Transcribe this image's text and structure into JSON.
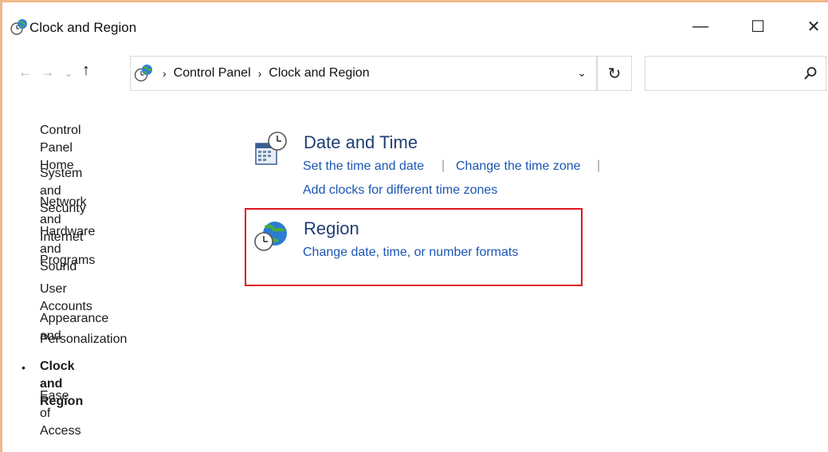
{
  "window": {
    "title": "Clock and Region",
    "controls": {
      "minimize": "—",
      "maximize": "☐",
      "close": "✕"
    }
  },
  "nav": {
    "back": "←",
    "forward": "→",
    "recent": "⌄",
    "up": "↑",
    "refresh": "↻",
    "dropdown": "⌄"
  },
  "address": {
    "separator": "›",
    "crumbs": [
      "Control Panel",
      "Clock and Region"
    ]
  },
  "search": {
    "placeholder": ""
  },
  "sidebar": {
    "items": [
      {
        "label": "Control Panel Home",
        "active": false
      },
      {
        "label": "System and Security",
        "active": false
      },
      {
        "label": "Network and Internet",
        "active": false
      },
      {
        "label": "Hardware and Sound",
        "active": false
      },
      {
        "label": "Programs",
        "active": false
      },
      {
        "label": "User Accounts",
        "active": false
      },
      {
        "label": "Appearance and",
        "active": false
      },
      {
        "label": "Personalization",
        "active": false
      },
      {
        "label": "Clock and Region",
        "active": true
      },
      {
        "label": "Ease of Access",
        "active": false
      }
    ],
    "bullet": "•"
  },
  "categories": [
    {
      "title": "Date and Time",
      "icon": "calendar-clock-icon",
      "links": [
        "Set the time and date",
        "Change the time zone",
        "Add clocks for different time zones"
      ],
      "separator": "|"
    },
    {
      "title": "Region",
      "icon": "globe-clock-icon",
      "links": [
        "Change date, time, or number formats"
      ]
    }
  ],
  "colors": {
    "accent_border": "#f0b98a",
    "link": "#1a56b3",
    "title": "#1f3f73",
    "highlight": "#e0141e"
  }
}
